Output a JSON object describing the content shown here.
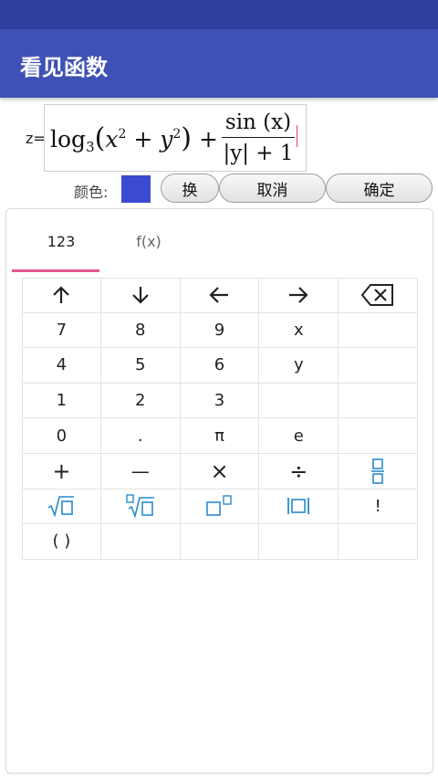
{
  "app": {
    "title": "看见函数"
  },
  "formula": {
    "prefix": "z=",
    "log_fn": "log",
    "log_base": "3",
    "var_x": "x",
    "var_y": "y",
    "exp": "2",
    "plus": "+",
    "frac_num": "sin (x)",
    "frac_den": "|y| + 1"
  },
  "color": {
    "label": "颜色:",
    "value": "#3b4bd0"
  },
  "buttons": {
    "swap": "换",
    "cancel": "取消",
    "confirm": "确定"
  },
  "tabs": [
    {
      "label": "123"
    },
    {
      "label": "f(x)"
    }
  ],
  "keys": {
    "r0": [
      "↑",
      "↓",
      "←",
      "→",
      "⌫"
    ],
    "r1": [
      "7",
      "8",
      "9",
      "x",
      ""
    ],
    "r2": [
      "4",
      "5",
      "6",
      "y",
      ""
    ],
    "r3": [
      "1",
      "2",
      "3",
      "",
      ""
    ],
    "r4": [
      "0",
      ".",
      "π",
      "e",
      ""
    ],
    "r5": [
      "+",
      "—",
      "×",
      "÷",
      "fraction"
    ],
    "r6": [
      "sqrt",
      "nth-root",
      "power",
      "abs",
      "!"
    ],
    "r7": [
      "( )",
      "",
      "",
      "",
      ""
    ]
  }
}
